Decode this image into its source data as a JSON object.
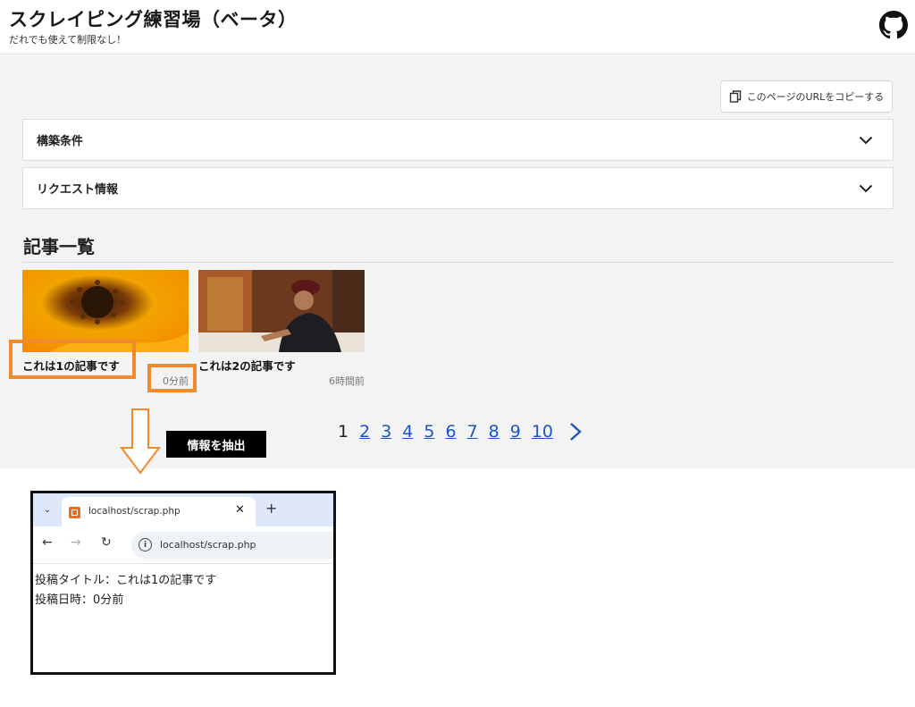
{
  "header": {
    "title": "スクレイピング練習場（ベータ）",
    "subtitle": "だれでも使えて制限なし！",
    "github_icon": "github-icon"
  },
  "toolbar": {
    "copy_label": "このページのURLをコピーする",
    "copy_icon": "copy-icon"
  },
  "accordions": [
    {
      "label": "構築条件"
    },
    {
      "label": "リクエスト情報"
    }
  ],
  "articles_section": {
    "title": "記事一覧",
    "cards": [
      {
        "title": "これは1の記事です",
        "time": "0分前",
        "image": "orange-flower-photo"
      },
      {
        "title": "これは2の記事です",
        "time": "6時間前",
        "image": "elderly-person-writing-photo"
      }
    ]
  },
  "pagination": {
    "pages": [
      "1",
      "2",
      "3",
      "4",
      "5",
      "6",
      "7",
      "8",
      "9",
      "10"
    ],
    "current": "1",
    "next_icon": "chevron-right-icon"
  },
  "annotation": {
    "label": "情報を抽出",
    "highlight_color": "#f08a2c"
  },
  "browser": {
    "tab_title": "localhost/scrap.php",
    "url": "localhost/scrap.php",
    "output_lines": [
      "投稿タイトル：これは1の記事です",
      "投稿日時：0分前"
    ]
  }
}
